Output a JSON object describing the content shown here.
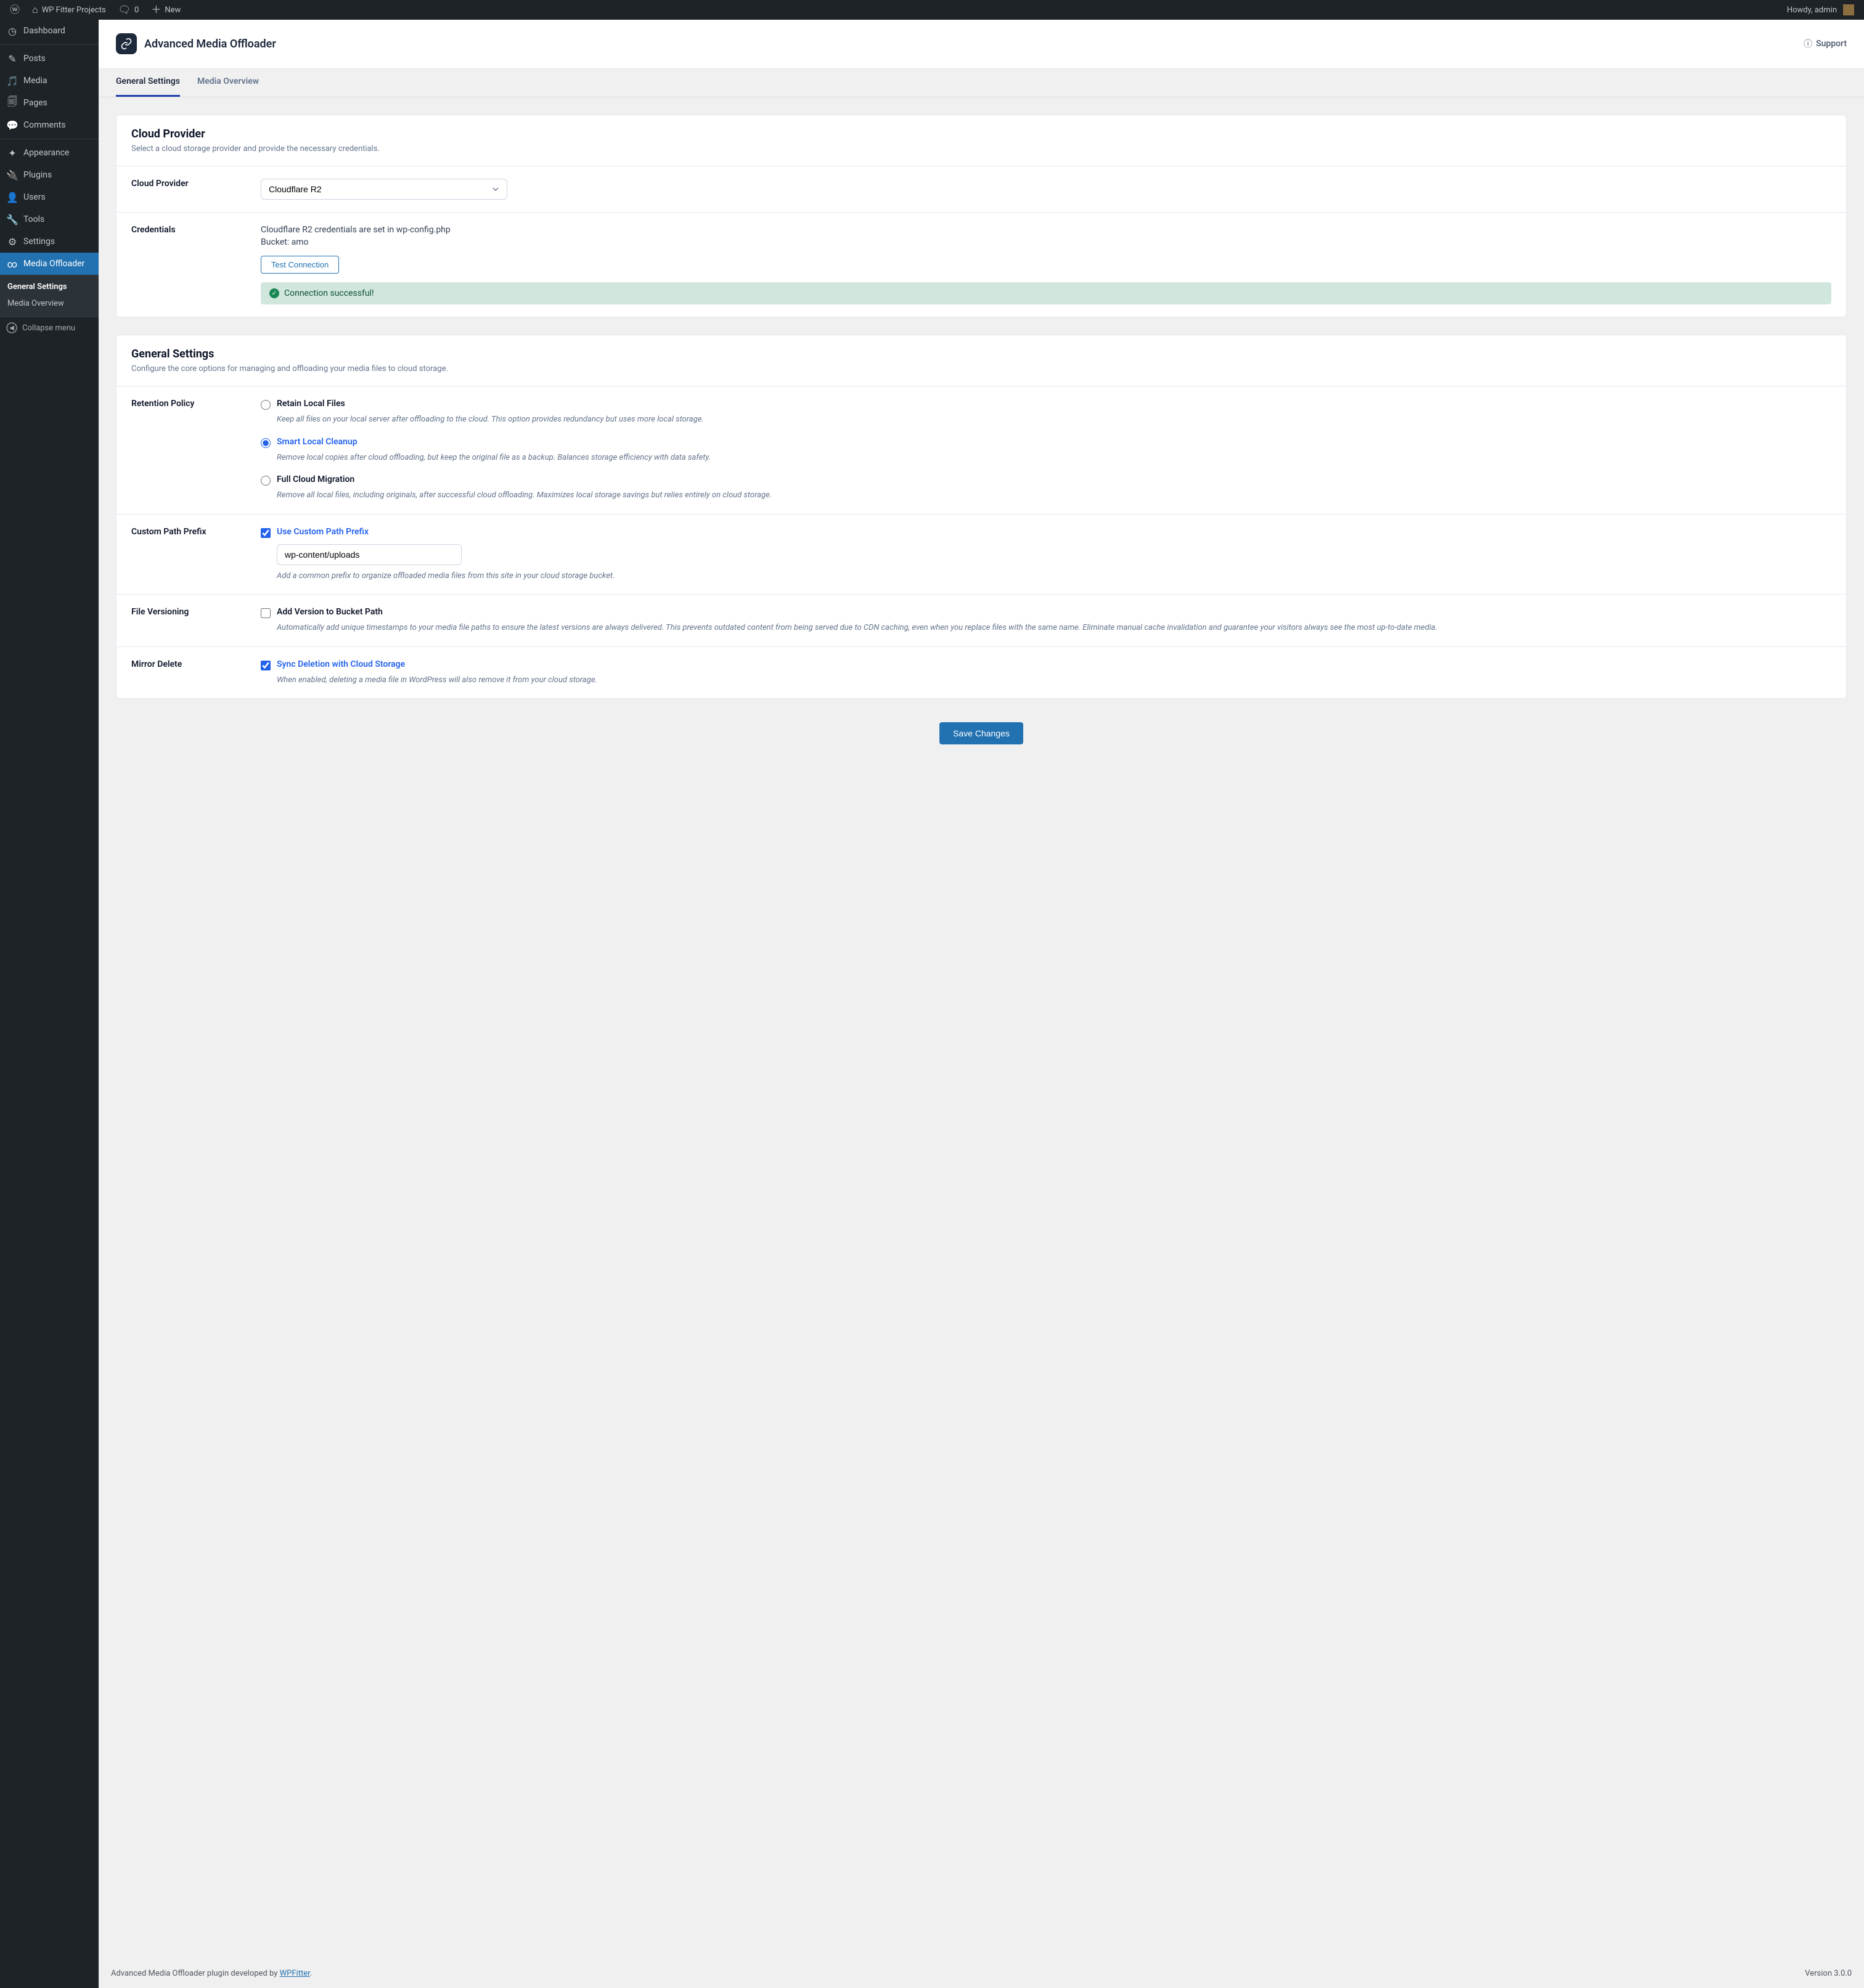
{
  "adminbar": {
    "site_title": "WP Fitter Projects",
    "comments_count": "0",
    "new_label": "New",
    "howdy": "Howdy, admin"
  },
  "sidebar": {
    "items": [
      {
        "label": "Dashboard",
        "icon": "◷"
      },
      {
        "label": "Posts",
        "icon": "✎"
      },
      {
        "label": "Media",
        "icon": "🎵"
      },
      {
        "label": "Pages",
        "icon": "🗐"
      },
      {
        "label": "Comments",
        "icon": "💬"
      },
      {
        "label": "Appearance",
        "icon": "✦"
      },
      {
        "label": "Plugins",
        "icon": "🔌"
      },
      {
        "label": "Users",
        "icon": "👤"
      },
      {
        "label": "Tools",
        "icon": "🔧"
      },
      {
        "label": "Settings",
        "icon": "⚙"
      },
      {
        "label": "Media Offloader",
        "icon": "∞"
      }
    ],
    "submenu": [
      {
        "label": "General Settings"
      },
      {
        "label": "Media Overview"
      }
    ],
    "collapse": "Collapse menu"
  },
  "header": {
    "title": "Advanced Media Offloader",
    "support": "Support"
  },
  "tabs": [
    {
      "label": "General Settings"
    },
    {
      "label": "Media Overview"
    }
  ],
  "cloud": {
    "heading": "Cloud Provider",
    "subheading": "Select a cloud storage provider and provide the necessary credentials.",
    "provider_label": "Cloud Provider",
    "provider_value": "Cloudflare R2",
    "credentials_label": "Credentials",
    "cred_line1": "Cloudflare R2 credentials are set in wp-config.php",
    "cred_line2": "Bucket: amo",
    "test_btn": "Test Connection",
    "success": "Connection successful!"
  },
  "general": {
    "heading": "General Settings",
    "subheading": "Configure the core options for managing and offloading your media files to cloud storage.",
    "retention_label": "Retention Policy",
    "retention_options": [
      {
        "title": "Retain Local Files",
        "desc": "Keep all files on your local server after offloading to the cloud. This option provides redundancy but uses more local storage."
      },
      {
        "title": "Smart Local Cleanup",
        "desc": "Remove local copies after cloud offloading, but keep the original file as a backup. Balances storage efficiency with data safety."
      },
      {
        "title": "Full Cloud Migration",
        "desc": "Remove all local files, including originals, after successful cloud offloading. Maximizes local storage savings but relies entirely on cloud storage."
      }
    ],
    "prefix_label": "Custom Path Prefix",
    "prefix_check": "Use Custom Path Prefix",
    "prefix_value": "wp-content/uploads",
    "prefix_desc": "Add a common prefix to organize offloaded media files from this site in your cloud storage bucket.",
    "version_label": "File Versioning",
    "version_check": "Add Version to Bucket Path",
    "version_desc": "Automatically add unique timestamps to your media file paths to ensure the latest versions are always delivered. This prevents outdated content from being served due to CDN caching, even when you replace files with the same name. Eliminate manual cache invalidation and guarantee your visitors always see the most up-to-date media.",
    "mirror_label": "Mirror Delete",
    "mirror_check": "Sync Deletion with Cloud Storage",
    "mirror_desc": "When enabled, deleting a media file in WordPress will also remove it from your cloud storage."
  },
  "save_btn": "Save Changes",
  "footer": {
    "text_pre": "Advanced Media Offloader plugin developed by ",
    "link": "WPFitter",
    "text_post": ".",
    "version": "Version 3.0.0"
  }
}
